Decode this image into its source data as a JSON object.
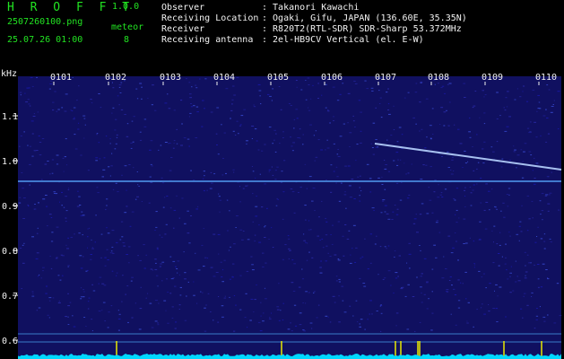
{
  "header": {
    "logo": "H R O F F T",
    "version": "1.0.0",
    "filename": "2507260100.png",
    "datetime": "25.07.26 01:00",
    "meteor_label": "meteor",
    "meteor_count": "8"
  },
  "info": [
    {
      "label": "Observer",
      "value": ": Takanori Kawachi"
    },
    {
      "label": "Receiving Location",
      "value": ": Ogaki, Gifu, JAPAN (136.60E, 35.35N)"
    },
    {
      "label": "Receiver",
      "value": ": R820T2(RTL-SDR) SDR-Sharp 53.372MHz"
    },
    {
      "label": "Receiving antenna",
      "value": ": 2el-HB9CV Vertical (el. E-W)"
    }
  ],
  "axis": {
    "unit_label": "kHz",
    "time_ticks": [
      "0101",
      "0102",
      "0103",
      "0104",
      "0105",
      "0106",
      "0107",
      "0108",
      "0109",
      "0110"
    ],
    "freq_ticks": [
      "1.1",
      "1.0",
      "0.9",
      "0.8",
      "0.7",
      "0.6"
    ],
    "freq_range_khz": [
      0.58,
      1.19
    ],
    "time_range_minutes": [
      0,
      10
    ]
  },
  "colors": {
    "background": "#000000",
    "waterfall_base": "#101060",
    "signal": "#c8e0ff",
    "grid_line": "#3a7cc8",
    "baseline_cyan": "#00e0ff",
    "spike_yellow": "#e8e800",
    "header_green": "#21e021",
    "header_white": "#f2f2f2"
  }
}
